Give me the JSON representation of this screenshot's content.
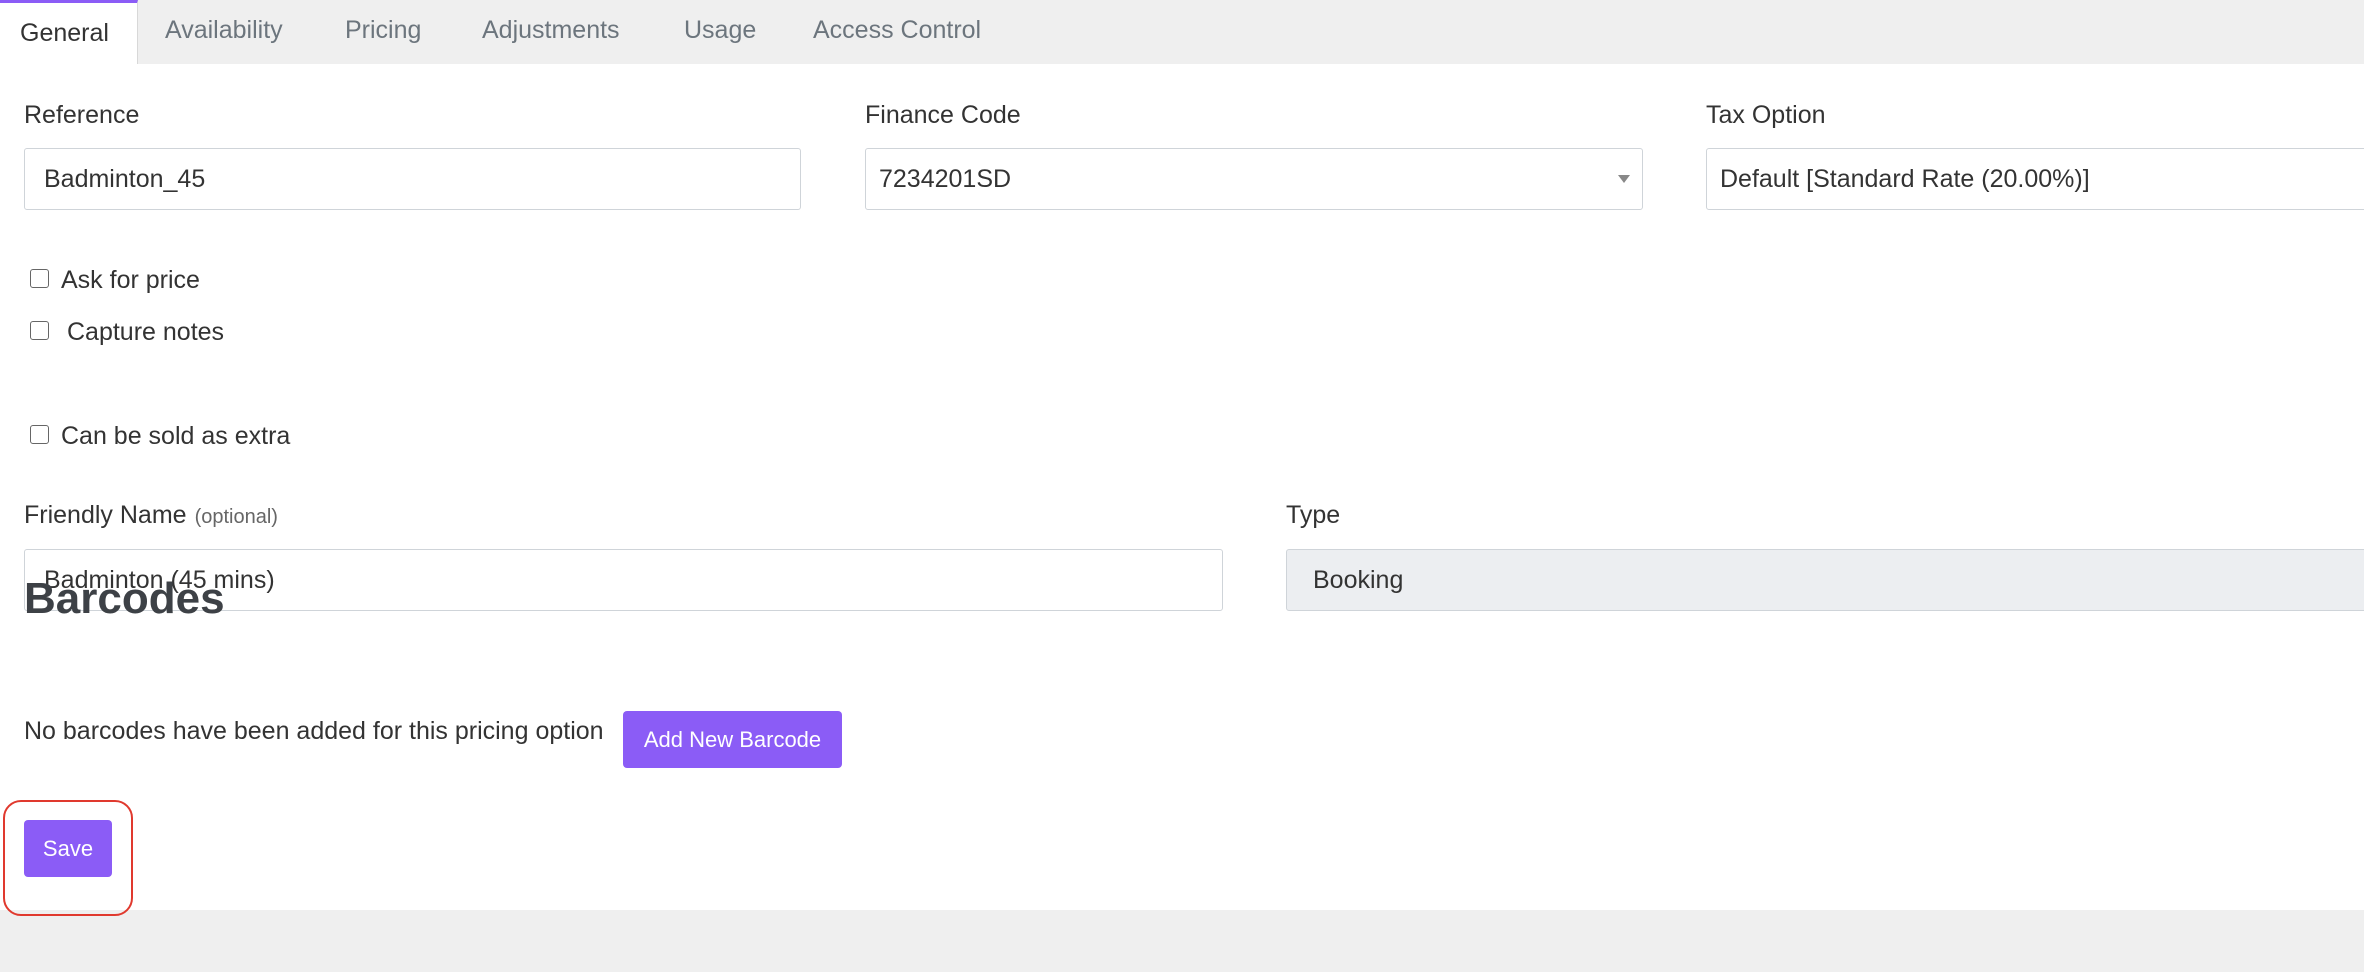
{
  "tabs": [
    {
      "label": "General",
      "active": true
    },
    {
      "label": "Availability"
    },
    {
      "label": "Pricing"
    },
    {
      "label": "Adjustments"
    },
    {
      "label": "Usage"
    },
    {
      "label": "Access Control"
    }
  ],
  "form": {
    "reference": {
      "label": "Reference",
      "value": "Badminton_45"
    },
    "finance_code": {
      "label": "Finance Code",
      "value": "7234201SD"
    },
    "tax_option": {
      "label": "Tax Option",
      "value": "Default [Standard Rate (20.00%)]"
    },
    "ask_for_price": {
      "label": "Ask for price",
      "checked": false
    },
    "capture_notes": {
      "label": "Capture notes",
      "checked": false
    },
    "sold_as_extra": {
      "label": "Can be sold as extra",
      "checked": false
    },
    "friendly_name": {
      "label": "Friendly Name",
      "optional_note": "(optional)",
      "value": "Badminton (45 mins)"
    },
    "type": {
      "label": "Type",
      "value": "Booking"
    }
  },
  "barcodes": {
    "heading": "Barcodes",
    "empty_message": "No barcodes have been added for this pricing option",
    "add_button": "Add New Barcode"
  },
  "actions": {
    "save_label": "Save"
  },
  "colors": {
    "accent": "#8b5cf6",
    "highlight": "#e0392e"
  }
}
